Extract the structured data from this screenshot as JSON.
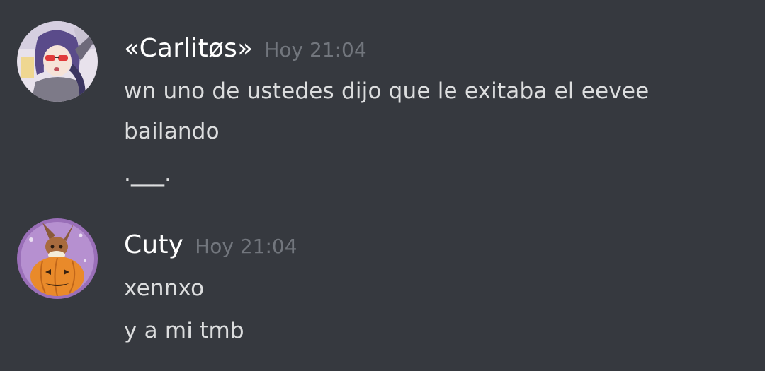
{
  "messages": [
    {
      "author": "«Carlitøs»",
      "timestamp": "Hoy 21:04",
      "avatar_icon": "anime-girl-avatar",
      "lines": [
        "wn uno de ustedes dijo que le exitaba el eevee",
        "bailando",
        ".___."
      ]
    },
    {
      "author": "Cuty",
      "timestamp": "Hoy 21:04",
      "avatar_icon": "eevee-pumpkin-avatar",
      "lines": [
        "xennxo",
        "y a mi tmb"
      ]
    }
  ],
  "colors": {
    "background": "#36393f",
    "username": "#ffffff",
    "timestamp": "#72767d",
    "message_text": "#dcddde"
  }
}
